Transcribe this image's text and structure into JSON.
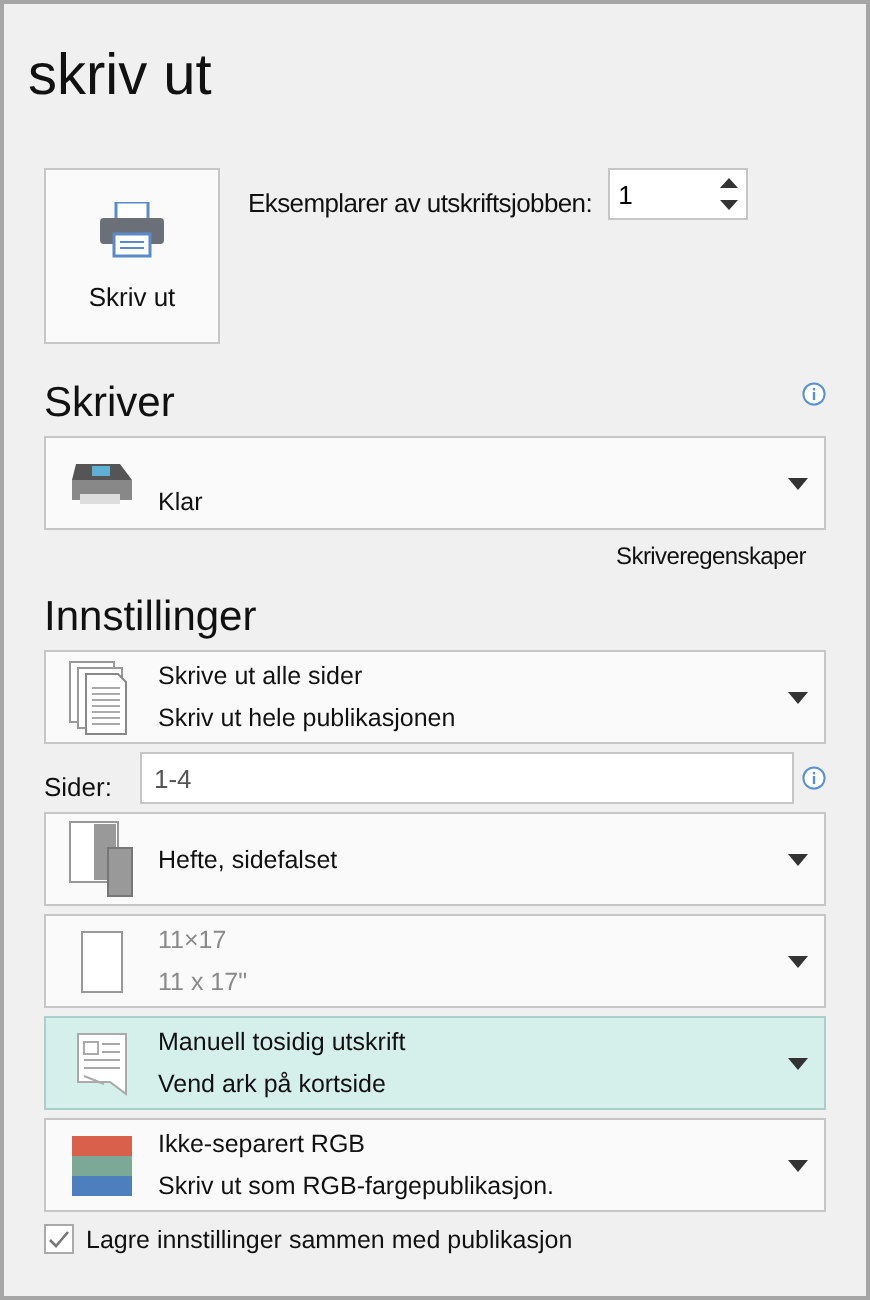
{
  "title": "skriv ut",
  "print_button": {
    "label": "Skriv ut"
  },
  "copies": {
    "label": "Eksemplarer av utskriftsjobben:",
    "value": "1"
  },
  "printer": {
    "heading": "Skriver",
    "status": "Klar",
    "properties_link": "Skriveregenskaper"
  },
  "settings": {
    "heading": "Innstillinger",
    "items": [
      {
        "kind": "all-pages",
        "primary": "Skrive ut alle sider",
        "secondary": "Skriv ut hele publikasjonen",
        "disabled": false,
        "highlighted": false
      },
      {
        "kind": "page-range",
        "label": "Sider:",
        "value": "1-4"
      },
      {
        "kind": "booklet",
        "primary": "Hefte, sidefalset",
        "disabled": false,
        "highlighted": false
      },
      {
        "kind": "paper-size",
        "primary": "11×17",
        "secondary": "11 x 17\"",
        "disabled": true,
        "highlighted": false
      },
      {
        "kind": "duplex",
        "primary": "Manuell tosidig utskrift",
        "secondary": "Vend ark på kortside",
        "disabled": false,
        "highlighted": true
      },
      {
        "kind": "color-mode",
        "primary": "Ikke-separert RGB",
        "secondary": "Skriv ut som RGB-fargepublikasjon.",
        "disabled": false,
        "highlighted": false
      }
    ]
  },
  "save_settings": {
    "label": "Lagre innstillinger sammen med publikasjon",
    "checked": true
  }
}
